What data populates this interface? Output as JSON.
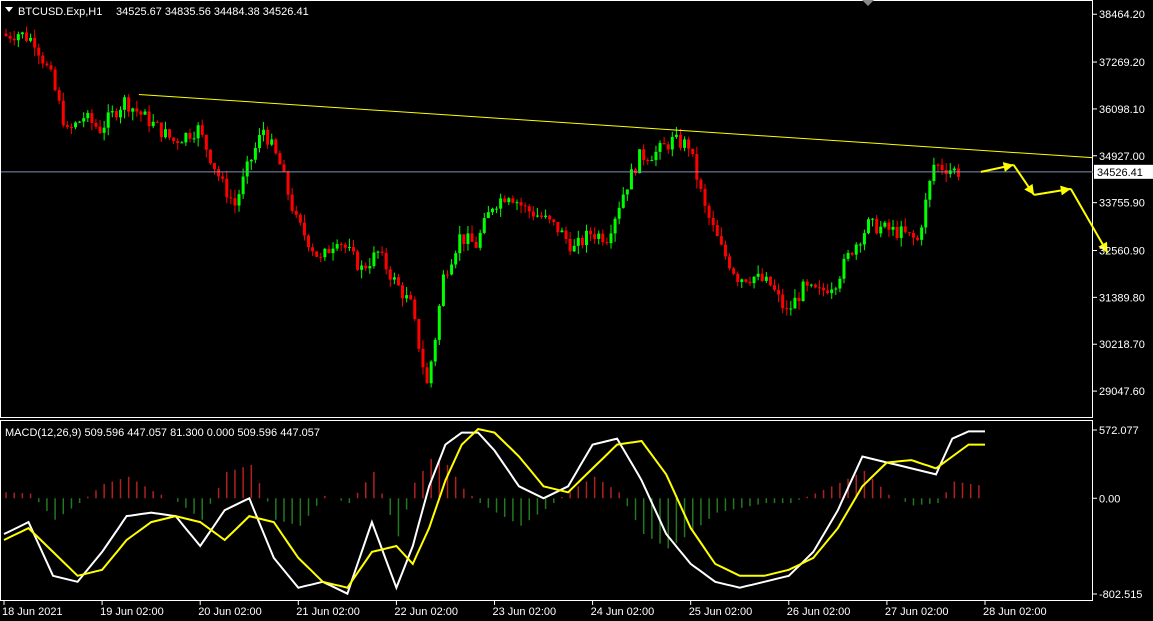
{
  "header": {
    "symbol": "BTCUSD.Exp,H1",
    "ohlc": "34525.67 34835.56 34484.38 34526.41"
  },
  "colors": {
    "background": "#000000",
    "axis": "#ffffff",
    "bull": "#00ff00",
    "bear": "#ff0000",
    "trendline": "#ffff00",
    "current_price_line": "#8090b0",
    "price_label_bg": "#ffffff",
    "macd_main": "#ffffff",
    "macd_signal": "#ffff00",
    "hist_pos": "#b02020",
    "hist_neg": "#1f7a1f",
    "forecast_arrow": "#ffff00"
  },
  "current_price_label": "34526.41",
  "price_axis": {
    "labels": [
      "38464.20",
      "37269.20",
      "36098.10",
      "34927.00",
      "33755.90",
      "32560.90",
      "31389.80",
      "30218.70",
      "29047.60"
    ],
    "values": [
      38464.2,
      37269.2,
      36098.1,
      34927.0,
      33755.9,
      32560.9,
      31389.8,
      30218.7,
      29047.6
    ]
  },
  "macd_panel": {
    "title": "MACD(12,26,9) 509.596 447.057 81.300 0.000 509.596 447.057",
    "labels": [
      "572.077",
      "0.00",
      "-802.515"
    ],
    "values": [
      572.077,
      0,
      -802.515
    ]
  },
  "time_axis": {
    "labels": [
      "18 Jun 2021",
      "19 Jun 02:00",
      "20 Jun 02:00",
      "21 Jun 02:00",
      "22 Jun 02:00",
      "23 Jun 02:00",
      "24 Jun 02:00",
      "25 Jun 02:00",
      "26 Jun 02:00",
      "27 Jun 02:00",
      "28 Jun 02:00"
    ],
    "bar_index": [
      0,
      24,
      48,
      72,
      96,
      120,
      144,
      168,
      192,
      216,
      240
    ]
  },
  "chart_data": {
    "type": "candlestick",
    "timeframe": "H1",
    "bars_total": 240,
    "ylim": [
      28800,
      38620
    ],
    "close_path": {
      "bar": [
        0,
        4,
        8,
        12,
        16,
        20,
        24,
        30,
        36,
        42,
        48,
        54,
        57,
        60,
        64,
        68,
        72,
        78,
        82,
        88,
        92,
        96,
        100,
        104,
        106,
        108,
        112,
        116,
        120,
        124,
        128,
        132,
        136,
        140,
        144,
        148,
        152,
        156,
        160,
        164,
        168,
        172,
        176,
        180,
        184,
        188,
        192,
        196,
        200,
        204,
        208,
        212,
        216,
        220,
        224,
        228,
        232,
        234,
        236,
        239
      ],
      "price": [
        37900,
        38000,
        37800,
        36900,
        35500,
        35900,
        35600,
        36300,
        35800,
        35300,
        35600,
        34200,
        33700,
        34600,
        35600,
        34700,
        33300,
        32300,
        32900,
        32100,
        32500,
        31800,
        31200,
        29200,
        30400,
        31900,
        32900,
        32700,
        33700,
        34000,
        33600,
        33400,
        33100,
        32600,
        33000,
        32900,
        34000,
        34900,
        35000,
        35300,
        35200,
        33600,
        32600,
        31900,
        31900,
        31700,
        31000,
        31600,
        31500,
        31800,
        32600,
        33200,
        33100,
        33000,
        32800,
        34700,
        34600,
        34526
      ]
    },
    "trendline": {
      "from": {
        "bar": 33,
        "price": 36460
      },
      "to": {
        "bar": 270,
        "price": 34880
      }
    },
    "current_price": 34526.41,
    "forecast_arrows": [
      {
        "from": {
          "bar": 239,
          "price": 34526
        },
        "to": {
          "bar": 247,
          "price": 34700
        }
      },
      {
        "from": {
          "bar": 247,
          "price": 34700
        },
        "to": {
          "bar": 252,
          "price": 33950
        }
      },
      {
        "from": {
          "bar": 252,
          "price": 33950
        },
        "to": {
          "bar": 261,
          "price": 34100
        }
      },
      {
        "from": {
          "bar": 261,
          "price": 34100
        },
        "to": {
          "bar": 270,
          "price": 32500
        }
      }
    ],
    "macd": {
      "main": {
        "bar": [
          0,
          6,
          12,
          18,
          24,
          30,
          36,
          42,
          48,
          54,
          60,
          66,
          72,
          78,
          84,
          90,
          96,
          100,
          104,
          108,
          112,
          116,
          120,
          126,
          132,
          138,
          144,
          150,
          156,
          162,
          168,
          174,
          180,
          186,
          192,
          198,
          204,
          210,
          216,
          222,
          228,
          232,
          236,
          240
        ],
        "value": [
          -300,
          -200,
          -650,
          -700,
          -450,
          -150,
          -120,
          -150,
          -400,
          -100,
          0,
          -500,
          -750,
          -700,
          -800,
          -200,
          -750,
          -400,
          100,
          450,
          550,
          550,
          400,
          100,
          0,
          100,
          450,
          500,
          150,
          -300,
          -550,
          -700,
          -750,
          -700,
          -650,
          -450,
          -100,
          350,
          300,
          250,
          200,
          500,
          560,
          560
        ]
      },
      "signal": {
        "bar": [
          0,
          6,
          12,
          18,
          24,
          30,
          36,
          42,
          48,
          54,
          60,
          66,
          72,
          78,
          84,
          90,
          96,
          100,
          104,
          108,
          112,
          116,
          120,
          126,
          132,
          138,
          144,
          150,
          156,
          162,
          168,
          174,
          180,
          186,
          192,
          198,
          204,
          210,
          216,
          222,
          228,
          232,
          236,
          240
        ],
        "value": [
          -350,
          -250,
          -450,
          -650,
          -600,
          -350,
          -200,
          -150,
          -200,
          -350,
          -150,
          -200,
          -500,
          -700,
          -750,
          -450,
          -400,
          -550,
          -250,
          150,
          450,
          580,
          550,
          350,
          100,
          50,
          250,
          450,
          480,
          200,
          -250,
          -550,
          -650,
          -650,
          -600,
          -500,
          -250,
          100,
          300,
          320,
          250,
          350,
          450,
          450
        ]
      },
      "histogram": {
        "bar": [
          0,
          6,
          12,
          18,
          24,
          30,
          36,
          42,
          48,
          54,
          60,
          66,
          72,
          78,
          84,
          90,
          96,
          100,
          104,
          108,
          112,
          116,
          120,
          126,
          132,
          138,
          144,
          150,
          156,
          162,
          168,
          174,
          180,
          186,
          192,
          198,
          204,
          210,
          216,
          222,
          228,
          232,
          236,
          240
        ],
        "value": [
          50,
          40,
          -180,
          -40,
          120,
          180,
          60,
          -30,
          -180,
          220,
          280,
          -180,
          -230,
          20,
          -40,
          220,
          -320,
          130,
          330,
          280,
          80,
          -40,
          -120,
          -230,
          -90,
          60,
          180,
          50,
          -300,
          -420,
          -280,
          -120,
          -80,
          -40,
          -40,
          40,
          130,
          230,
          30,
          -60,
          -40,
          140,
          120,
          100
        ]
      }
    }
  }
}
